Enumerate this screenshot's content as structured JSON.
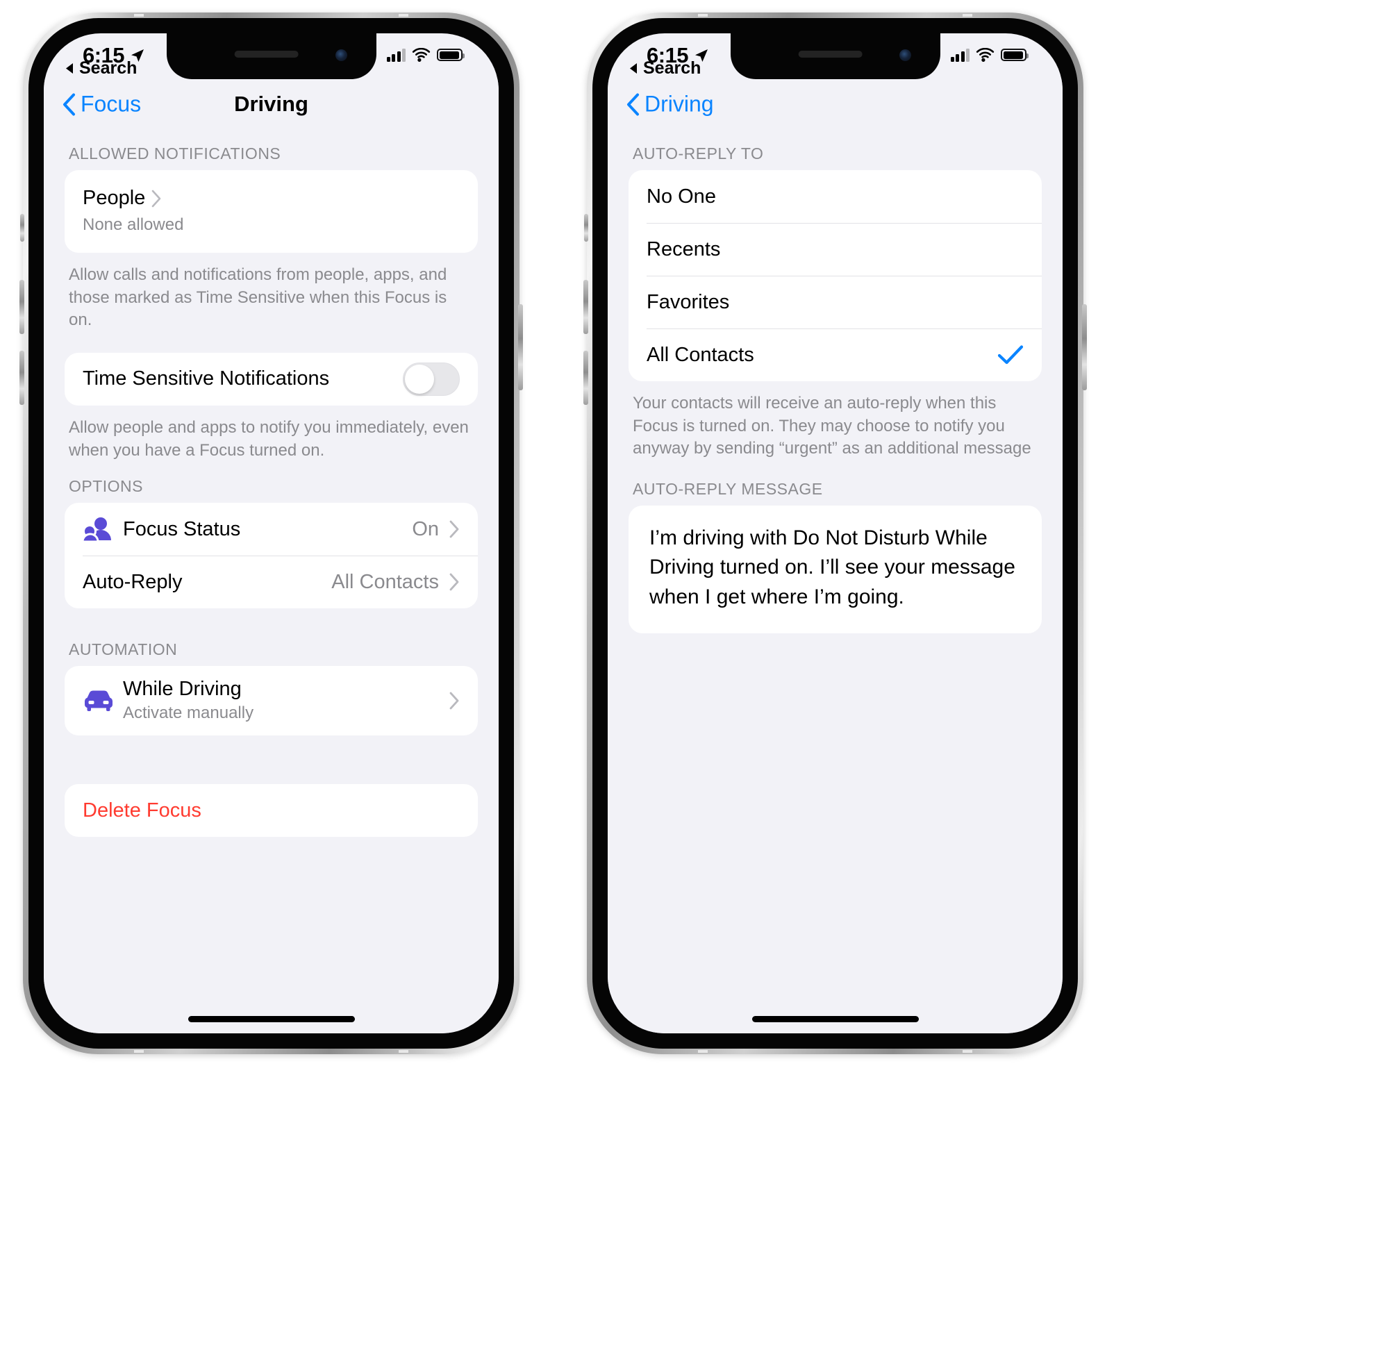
{
  "status_bar": {
    "time": "6:15",
    "location_icon": "location-arrow-icon",
    "signal_icon": "cellular-signal-icon",
    "wifi_icon": "wifi-icon",
    "battery_icon": "battery-icon"
  },
  "back_to_app": {
    "label": "Search",
    "icon": "back-triangle-icon"
  },
  "left_phone": {
    "nav": {
      "back_label": "Focus",
      "title": "Driving"
    },
    "sections": {
      "allowed_notifications": {
        "header": "ALLOWED NOTIFICATIONS",
        "people_label": "People",
        "people_detail": "None allowed",
        "footnote": "Allow calls and notifications from people, apps, and those marked as Time Sensitive when this Focus is on."
      },
      "time_sensitive": {
        "label": "Time Sensitive Notifications",
        "toggle_state": "off",
        "footnote": "Allow people and apps to notify you immediately, even when you have a Focus turned on."
      },
      "options": {
        "header": "OPTIONS",
        "rows": [
          {
            "label": "Focus Status",
            "value": "On",
            "icon": "focus-status-people-icon"
          },
          {
            "label": "Auto-Reply",
            "value": "All Contacts",
            "icon": ""
          }
        ]
      },
      "automation": {
        "header": "AUTOMATION",
        "row": {
          "title": "While Driving",
          "subtitle": "Activate manually",
          "icon": "car-icon"
        }
      },
      "delete": {
        "label": "Delete Focus"
      }
    }
  },
  "right_phone": {
    "nav": {
      "back_label": "Driving",
      "title": ""
    },
    "sections": {
      "auto_reply_to": {
        "header": "AUTO-REPLY TO",
        "options": [
          {
            "label": "No One",
            "selected": false
          },
          {
            "label": "Recents",
            "selected": false
          },
          {
            "label": "Favorites",
            "selected": false
          },
          {
            "label": "All Contacts",
            "selected": true
          }
        ],
        "footnote": "Your contacts will receive an auto-reply when this Focus is turned on. They may choose to notify you anyway by sending “urgent” as an additional message"
      },
      "auto_reply_message": {
        "header": "AUTO-REPLY MESSAGE",
        "message": "I’m driving with Do Not Disturb While Driving turned on. I’ll see your message when I get where I’m going."
      }
    }
  },
  "colors": {
    "accent_blue": "#0a84ff",
    "destructive_red": "#ff3b30",
    "focus_purple": "#5a4bd6",
    "grouped_bg": "#f2f2f7",
    "secondary_label": "#8a8a8e"
  }
}
